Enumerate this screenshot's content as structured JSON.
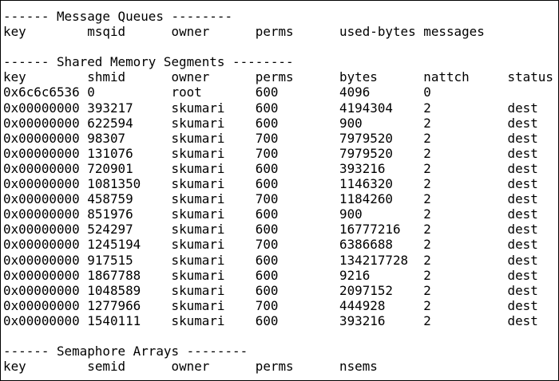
{
  "message_queues": {
    "header": "------ Message Queues --------",
    "columns": [
      "key",
      "msqid",
      "owner",
      "perms",
      "used-bytes",
      "messages"
    ],
    "rows": []
  },
  "shared_memory": {
    "header": "------ Shared Memory Segments --------",
    "columns": [
      "key",
      "shmid",
      "owner",
      "perms",
      "bytes",
      "nattch",
      "status"
    ],
    "rows": [
      [
        "0x6c6c6536",
        "0",
        "root",
        "600",
        "4096",
        "0",
        ""
      ],
      [
        "0x00000000",
        "393217",
        "skumari",
        "600",
        "4194304",
        "2",
        "dest"
      ],
      [
        "0x00000000",
        "622594",
        "skumari",
        "600",
        "900",
        "2",
        "dest"
      ],
      [
        "0x00000000",
        "98307",
        "skumari",
        "700",
        "7979520",
        "2",
        "dest"
      ],
      [
        "0x00000000",
        "131076",
        "skumari",
        "700",
        "7979520",
        "2",
        "dest"
      ],
      [
        "0x00000000",
        "720901",
        "skumari",
        "600",
        "393216",
        "2",
        "dest"
      ],
      [
        "0x00000000",
        "1081350",
        "skumari",
        "600",
        "1146320",
        "2",
        "dest"
      ],
      [
        "0x00000000",
        "458759",
        "skumari",
        "700",
        "1184260",
        "2",
        "dest"
      ],
      [
        "0x00000000",
        "851976",
        "skumari",
        "600",
        "900",
        "2",
        "dest"
      ],
      [
        "0x00000000",
        "524297",
        "skumari",
        "600",
        "16777216",
        "2",
        "dest"
      ],
      [
        "0x00000000",
        "1245194",
        "skumari",
        "700",
        "6386688",
        "2",
        "dest"
      ],
      [
        "0x00000000",
        "917515",
        "skumari",
        "600",
        "134217728",
        "2",
        "dest"
      ],
      [
        "0x00000000",
        "1867788",
        "skumari",
        "600",
        "9216",
        "2",
        "dest"
      ],
      [
        "0x00000000",
        "1048589",
        "skumari",
        "600",
        "2097152",
        "2",
        "dest"
      ],
      [
        "0x00000000",
        "1277966",
        "skumari",
        "700",
        "444928",
        "2",
        "dest"
      ],
      [
        "0x00000000",
        "1540111",
        "skumari",
        "600",
        "393216",
        "2",
        "dest"
      ]
    ]
  },
  "semaphores": {
    "header": "------ Semaphore Arrays --------",
    "columns": [
      "key",
      "semid",
      "owner",
      "perms",
      "nsems"
    ],
    "rows": []
  }
}
